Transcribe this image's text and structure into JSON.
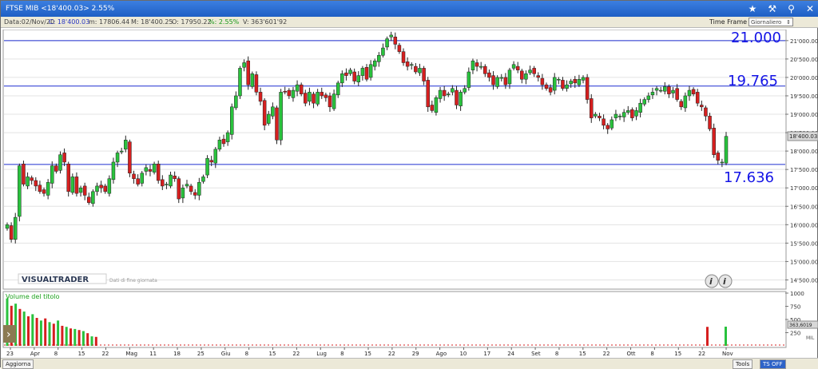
{
  "window": {
    "title": "FTSE MIB  <18'400.03>  2.55%",
    "icons": [
      "star-icon",
      "hammer-icon",
      "pin-icon",
      "close-icon"
    ]
  },
  "infobar": {
    "data": "Data:02/Nov/20",
    "close": "C: 18'400.03",
    "min": "m: 17806.44",
    "max": "M: 18'400.25",
    "open": "O: 17950.22",
    "pct": "%: 2.55%",
    "volume": "V: 363'601'92",
    "time_frame_label": "Time Frame",
    "time_frame_value": "Giornaliero"
  },
  "colors": {
    "up": "#29c23d",
    "down": "#d61f1f",
    "level_lines": "#1e2fd0",
    "level_text": "#1414e6",
    "title_bar": "#1e5fc4",
    "volume_label": "#1aa11a"
  },
  "levels": {
    "l1": "21.000",
    "l2": "19.765",
    "l3": "17.636"
  },
  "watermark": {
    "brand": "VISUALTRADER",
    "subtitle": "Dati di fine giornata",
    "info_icons": [
      "info-icon",
      "info-icon"
    ]
  },
  "volume_panel": {
    "label": "Volume del titolo",
    "ticks": [
      "1000",
      "750",
      "500",
      "250"
    ],
    "unit": "MIL",
    "current": "363,6019"
  },
  "bottombar": {
    "aggiorna": "Aggiorna",
    "tools": "Tools",
    "ts_off": "TS OFF"
  },
  "chart_data": {
    "type": "candlestick",
    "title": "FTSE MIB",
    "ylim": [
      14250,
      21300
    ],
    "yticks": [
      "21'000.00",
      "20'500.00",
      "20'000.00",
      "19'500.00",
      "19'000.00",
      "18'500.00",
      "18'000.00",
      "17'500.00",
      "17'000.00",
      "16'500.00",
      "16'000.00",
      "15'500.00",
      "15'000.00",
      "14'500.00"
    ],
    "price_tag": "18'400.03",
    "horizontal_levels": [
      21000,
      19765,
      17636
    ],
    "x_labels": [
      "23",
      "Apr",
      "8",
      "15",
      "22",
      "Mag",
      "11",
      "18",
      "25",
      "Giu",
      "8",
      "15",
      "22",
      "Lug",
      "8",
      "15",
      "22",
      "29",
      "Ago",
      "10",
      "17",
      "24",
      "Set",
      "8",
      "15",
      "22",
      "Ott",
      "8",
      "15",
      "22",
      "Nov"
    ],
    "ohlc_closes": [
      16000,
      15600,
      16200,
      17600,
      17100,
      17300,
      17200,
      17050,
      16900,
      16850,
      17150,
      17600,
      17450,
      17900,
      17700,
      16900,
      17300,
      16850,
      17000,
      16800,
      16600,
      16900,
      17050,
      17000,
      16900,
      17250,
      17700,
      17950,
      18000,
      18300,
      17400,
      17250,
      17100,
      17400,
      17550,
      17450,
      17650,
      17200,
      17050,
      17100,
      17350,
      17250,
      16700,
      17000,
      17100,
      16900,
      16800,
      17150,
      17300,
      17800,
      17700,
      18050,
      18300,
      18200,
      18500,
      19200,
      19500,
      20250,
      20400,
      19800,
      20100,
      19600,
      19350,
      18700,
      19000,
      19200,
      18300,
      19600,
      19600,
      19500,
      19650,
      19800,
      19550,
      19300,
      19600,
      19300,
      19600,
      19500,
      19450,
      19200,
      19550,
      19850,
      20100,
      20050,
      20200,
      19900,
      20050,
      20250,
      19950,
      20350,
      20450,
      20600,
      20800,
      21050,
      21150,
      20900,
      20700,
      20400,
      20300,
      20350,
      20150,
      20250,
      19900,
      19200,
      19100,
      19450,
      19650,
      19500,
      19550,
      19700,
      19250,
      19600,
      19700,
      20150,
      20450,
      20300,
      20300,
      20100,
      20000,
      19800,
      20000,
      20000,
      19800,
      20200,
      20350,
      20200,
      19950,
      20100,
      20200,
      20100,
      20000,
      19800,
      19700,
      19600,
      20000,
      19950,
      19700,
      19800,
      19900,
      19850,
      19950,
      20000,
      19400,
      18900,
      19000,
      18900,
      18700,
      18600,
      18850,
      19000,
      18950,
      19050,
      19100,
      18900,
      19100,
      19300,
      19400,
      19500,
      19600,
      19700,
      19650,
      19750,
      19550,
      19650,
      19400,
      19200,
      19500,
      19650,
      19550,
      19300,
      19200,
      18950,
      18600,
      17900,
      17750,
      17700,
      18400
    ],
    "volume_series": [
      {
        "name": "Volume del titolo",
        "values": [
          900,
          760,
          800,
          700,
          650,
          560,
          600,
          530,
          480,
          520,
          450,
          420,
          480,
          380,
          360,
          330,
          320,
          300,
          280,
          240,
          180,
          170
        ]
      }
    ]
  }
}
